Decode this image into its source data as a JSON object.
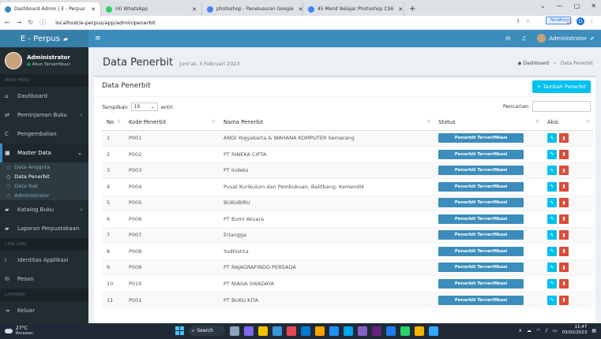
{
  "browser": {
    "tabs": [
      {
        "title": "Dashboard Admin | E - Perpus",
        "active": true,
        "color": "#3c8dbc"
      },
      {
        "title": "(4) WhatsApp",
        "active": false,
        "color": "#25d366"
      },
      {
        "title": "photoshop - Penelusuran Google",
        "active": false,
        "color": "#4285f4"
      },
      {
        "title": "45 Menit Belajar Photoshop CS6",
        "active": false,
        "color": "#4285f4"
      }
    ],
    "url": "localhost/e-perpus/app/admin/penerbit",
    "tooltip": "TeraBox",
    "profile_initial": "D"
  },
  "header": {
    "brand": "E - Perpus",
    "user": "Administrator"
  },
  "sidebar": {
    "user_name": "Administrator",
    "user_status": "Akun Terverifikasi",
    "sections": {
      "main": "MAIN MENU",
      "lain": "LAIN LAIN",
      "layanan": "LAYANAN"
    },
    "items": {
      "dashboard": "Dashboard",
      "peminjaman": "Peminjaman Buku",
      "pengembalian": "Pengembalian",
      "master": "Master Data",
      "katalog": "Katalog Buku",
      "laporan": "Laporan Perpustakaan",
      "identitas": "Identitas Applikasi",
      "pesan": "Pesan",
      "keluar": "Keluar"
    },
    "sub_items": {
      "anggota": "Data Anggota",
      "penerbit": "Data Penerbit",
      "rak": "Data Rak",
      "admin": "Administrator"
    }
  },
  "page": {
    "title": "Data Penerbit",
    "subtitle": "Jum'at, 3 Februari 2023",
    "crumb_home": "Dashboard",
    "crumb_current": "Data Penerbit",
    "box_title": "Data Penerbit",
    "add_label": "+ Tambah Penerbit",
    "show_label": "Tampilkan",
    "show_value": "10",
    "entries_label": "entri",
    "search_label": "Pencarian:"
  },
  "table": {
    "headers": [
      "No",
      "Kode Penerbit",
      "Nama Penerbit",
      "Status",
      "Aksi"
    ],
    "status_label": "Penerbit Terverifikasi",
    "rows": [
      {
        "no": "1",
        "kode": "P001",
        "nama": "ANDI Yogyakarta & WAHANA KOMPUTER Semarang"
      },
      {
        "no": "2",
        "kode": "P002",
        "nama": "PT RINEKA CIPTA"
      },
      {
        "no": "3",
        "kode": "P003",
        "nama": "PT Indeks"
      },
      {
        "no": "4",
        "kode": "P004",
        "nama": "Pusat Kurikulum dan Pembukuan, Balitbang, Kemendik"
      },
      {
        "no": "5",
        "kode": "P005",
        "nama": "BUKUBIRU"
      },
      {
        "no": "6",
        "kode": "P006",
        "nama": "PT Bumi Aksara"
      },
      {
        "no": "7",
        "kode": "P007",
        "nama": "Erlangga"
      },
      {
        "no": "8",
        "kode": "P008",
        "nama": "Yudhistira"
      },
      {
        "no": "9",
        "kode": "P009",
        "nama": "PT RAJAGRAFINDO PERSADA"
      },
      {
        "no": "10",
        "kode": "P010",
        "nama": "PT NIAGA SWADAYA"
      },
      {
        "no": "11",
        "kode": "P001",
        "nama": "PT BUKU KITA"
      }
    ]
  },
  "taskbar": {
    "temp": "27°C",
    "weather": "Berawan",
    "search": "Search",
    "time": "11:47",
    "date": "03/02/2023"
  }
}
